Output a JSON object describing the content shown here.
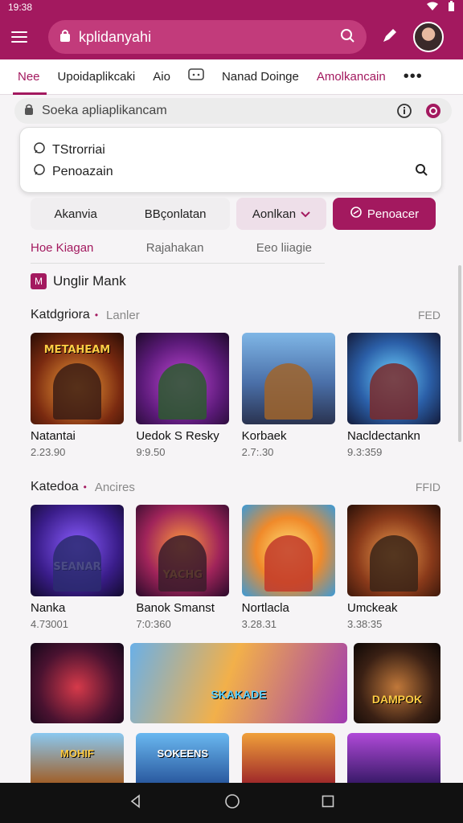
{
  "status_bar": {
    "time": "19:38"
  },
  "app_bar": {
    "search_text": "kplidanyahi"
  },
  "tabs": [
    {
      "label": "Nee"
    },
    {
      "label": "Upoidaplikcaki"
    },
    {
      "label": "Aio"
    },
    {
      "label": "Nanad Doinge"
    },
    {
      "label": "Amolkancain"
    }
  ],
  "sub_search": {
    "text": "Soeka apliaplikancam"
  },
  "dropdown": {
    "items": [
      {
        "label": "TStrorriai"
      },
      {
        "label": "Penoazain"
      }
    ]
  },
  "filters": {
    "group_a": "Akanvia",
    "group_b": "BBçonlatan",
    "dropdown_label": "Aonlkan",
    "primary_label": "Penoacer"
  },
  "filter_tabs": [
    {
      "label": "Hoe Kiagan"
    },
    {
      "label": "Rajahakan"
    },
    {
      "label": "Eeo liiagie"
    }
  ],
  "section": {
    "icon_letter": "M",
    "title": "Unglir Mank"
  },
  "category1": {
    "title": "Katdgriora",
    "sub": "Lanler",
    "more": "FED"
  },
  "category2": {
    "title": "Katedoa",
    "sub": "Ancires",
    "more": "FFID"
  },
  "row1": [
    {
      "thumb_title": "METAHEAM",
      "name": "Natantai",
      "stat": "2.23.90"
    },
    {
      "thumb_title": "",
      "name": "Uedok S Resky",
      "stat": "9:9.50"
    },
    {
      "thumb_title": "",
      "name": "Korbaek",
      "stat": "2.7:.30"
    },
    {
      "thumb_title": "",
      "name": "Nacldectankn",
      "stat": "9.3:359"
    }
  ],
  "row2": [
    {
      "thumb_title": "SEANAR",
      "name": "Nanka",
      "stat": "4.73001"
    },
    {
      "thumb_title": "YACHG",
      "name": "Banok Smanst",
      "stat": "7:0:360"
    },
    {
      "thumb_title": "",
      "name": "Nortlacla",
      "stat": "3.28.31"
    },
    {
      "thumb_title": "",
      "name": "Umckeak",
      "stat": "3.38:35"
    }
  ],
  "row3": [
    {
      "thumb_title": ""
    },
    {
      "thumb_title": "SKAKADE"
    },
    {
      "thumb_title": "DAMPOK"
    }
  ],
  "row4": [
    {
      "thumb_title": "MOHIF"
    },
    {
      "thumb_title": "SOKEENS"
    },
    {
      "thumb_title": ""
    },
    {
      "thumb_title": ""
    }
  ],
  "colors": {
    "brand": "#a3195f"
  }
}
